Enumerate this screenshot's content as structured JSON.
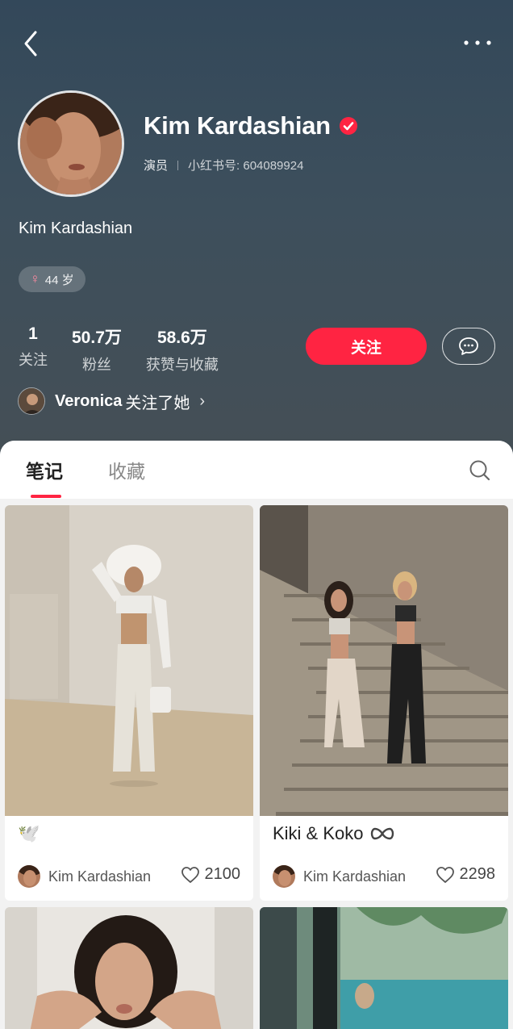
{
  "profile": {
    "name": "Kim Kardashian",
    "role": "演员",
    "id_label": "小红书号: 604089924",
    "bio": "Kim Kardashian",
    "age": "44 岁",
    "gender_symbol": "♀"
  },
  "stats": [
    {
      "num": "1",
      "label": "关注"
    },
    {
      "num": "50.7万",
      "label": "粉丝"
    },
    {
      "num": "58.6万",
      "label": "获赞与收藏"
    }
  ],
  "actions": {
    "follow_label": "关注"
  },
  "mutual": {
    "name": "Veronica",
    "text": "关注了她",
    "chevron": "›"
  },
  "tabs": [
    {
      "label": "笔记",
      "active": true
    },
    {
      "label": "收藏",
      "active": false
    }
  ],
  "notes": [
    {
      "title": "🕊️",
      "author": "Kim Kardashian",
      "likes": "2100"
    },
    {
      "title": "Kiki & Koko",
      "title_icon": "infinity-icon",
      "author": "Kim Kardashian",
      "likes": "2298"
    }
  ],
  "colors": {
    "accent": "#ff2442",
    "header_bg": "#3d4f5c"
  }
}
